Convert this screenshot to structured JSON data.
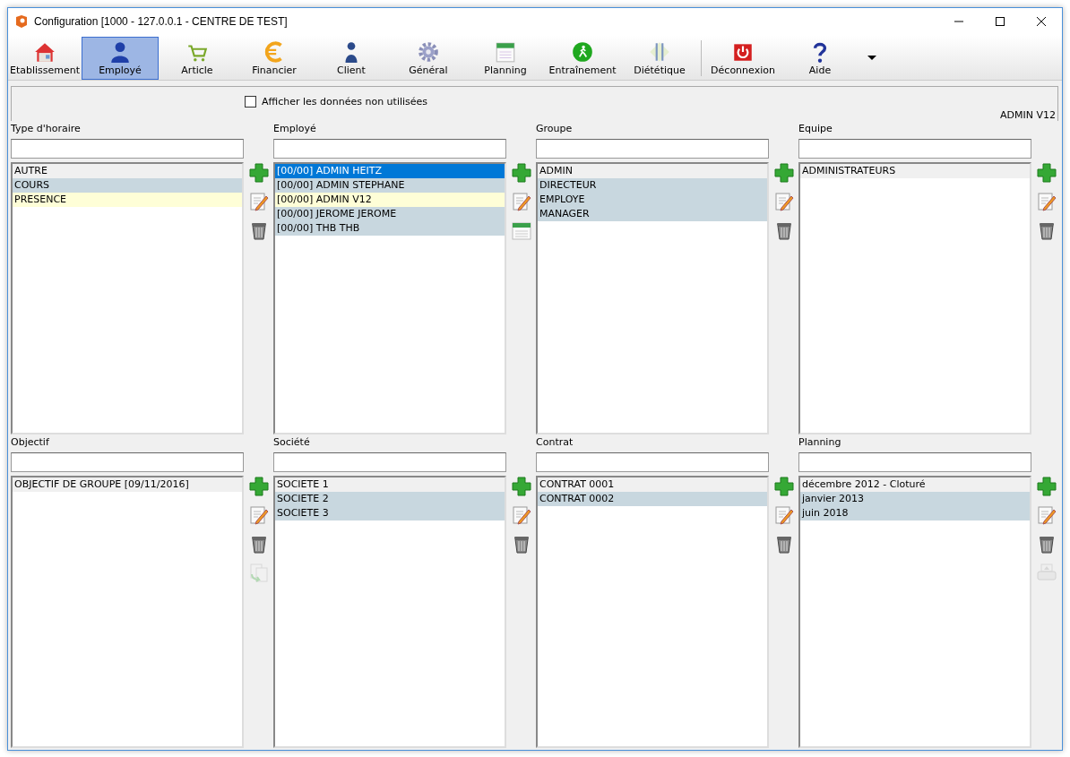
{
  "window": {
    "title": "Configuration [1000 - 127.0.0.1 - CENTRE DE TEST]"
  },
  "toolbar": {
    "items": [
      {
        "label": "Etablissement",
        "selected": false
      },
      {
        "label": "Employé",
        "selected": true
      },
      {
        "label": "Article",
        "selected": false
      },
      {
        "label": "Financier",
        "selected": false
      },
      {
        "label": "Client",
        "selected": false
      },
      {
        "label": "Général",
        "selected": false
      },
      {
        "label": "Planning",
        "selected": false
      },
      {
        "label": "Entraînement",
        "selected": false
      },
      {
        "label": "Diététique",
        "selected": false
      },
      {
        "label": "Déconnexion",
        "selected": false
      },
      {
        "label": "Aide",
        "selected": false
      }
    ]
  },
  "header": {
    "checkbox": {
      "label": "Afficher les données non utilisées",
      "checked": false
    },
    "user": "ADMIN V12"
  },
  "panels": [
    {
      "title": "Type d'horaire",
      "rows": [
        {
          "text": "AUTRE",
          "color": "#f0f0f0",
          "selected": false
        },
        {
          "text": "COURS",
          "color": "#c8d7df",
          "selected": false
        },
        {
          "text": "PRESENCE",
          "color": "#fefed7",
          "selected": false
        }
      ],
      "actions": [
        {
          "kind": "add",
          "disabled": false
        },
        {
          "kind": "edit",
          "disabled": false
        },
        {
          "kind": "delete",
          "disabled": false
        }
      ]
    },
    {
      "title": "Employé",
      "rows": [
        {
          "text": "[00/00] ADMIN HEITZ",
          "selected": true
        },
        {
          "text": "[00/00] ADMIN STEPHANE",
          "color": "#c8d7df",
          "selected": false
        },
        {
          "text": "[00/00] ADMIN V12",
          "color": "#fefed7",
          "selected": false
        },
        {
          "text": "[00/00] JEROME JEROME",
          "color": "#c8d7df",
          "selected": false
        },
        {
          "text": "[00/00] THB THB",
          "color": "#c8d7df",
          "selected": false
        }
      ],
      "actions": [
        {
          "kind": "add",
          "disabled": false
        },
        {
          "kind": "edit",
          "disabled": false
        },
        {
          "kind": "calendar",
          "disabled": false
        }
      ]
    },
    {
      "title": "Groupe",
      "rows": [
        {
          "text": "ADMIN",
          "color": "#f0f0f0",
          "selected": false
        },
        {
          "text": "DIRECTEUR",
          "color": "#c8d7df",
          "selected": false
        },
        {
          "text": "EMPLOYE",
          "color": "#c8d7df",
          "selected": false
        },
        {
          "text": "MANAGER",
          "color": "#c8d7df",
          "selected": false
        }
      ],
      "actions": [
        {
          "kind": "add",
          "disabled": false
        },
        {
          "kind": "edit",
          "disabled": false
        },
        {
          "kind": "delete",
          "disabled": false
        }
      ]
    },
    {
      "title": "Equipe",
      "rows": [
        {
          "text": "ADMINISTRATEURS",
          "color": "#f0f0f0",
          "selected": false
        }
      ],
      "actions": [
        {
          "kind": "add",
          "disabled": false
        },
        {
          "kind": "edit",
          "disabled": false
        },
        {
          "kind": "delete",
          "disabled": false
        }
      ]
    },
    {
      "title": "Objectif",
      "rows": [
        {
          "text": "OBJECTIF DE GROUPE [09/11/2016]",
          "color": "#f0f0f0",
          "selected": false
        }
      ],
      "actions": [
        {
          "kind": "add",
          "disabled": false
        },
        {
          "kind": "edit",
          "disabled": false
        },
        {
          "kind": "delete",
          "disabled": false
        },
        {
          "kind": "copy",
          "disabled": true
        }
      ]
    },
    {
      "title": "Société",
      "rows": [
        {
          "text": "SOCIETE 1",
          "color": "#f0f0f0",
          "selected": false
        },
        {
          "text": "SOCIETE 2",
          "color": "#c8d7df",
          "selected": false
        },
        {
          "text": "SOCIETE 3",
          "color": "#c8d7df",
          "selected": false
        }
      ],
      "actions": [
        {
          "kind": "add",
          "disabled": false
        },
        {
          "kind": "edit",
          "disabled": false
        },
        {
          "kind": "delete",
          "disabled": false
        }
      ]
    },
    {
      "title": "Contrat",
      "rows": [
        {
          "text": "CONTRAT 0001",
          "color": "#f0f0f0",
          "selected": false
        },
        {
          "text": "CONTRAT 0002",
          "color": "#c8d7df",
          "selected": false
        }
      ],
      "actions": [
        {
          "kind": "add",
          "disabled": false
        },
        {
          "kind": "edit",
          "disabled": false
        },
        {
          "kind": "delete",
          "disabled": false
        }
      ]
    },
    {
      "title": "Planning",
      "rows": [
        {
          "text": "décembre 2012 - Cloturé",
          "color": "#f0f0f0",
          "selected": false
        },
        {
          "text": "janvier 2013",
          "color": "#c8d7df",
          "selected": false
        },
        {
          "text": "juin 2018",
          "color": "#c8d7df",
          "selected": false
        }
      ],
      "actions": [
        {
          "kind": "add",
          "disabled": false
        },
        {
          "kind": "edit",
          "disabled": false
        },
        {
          "kind": "delete",
          "disabled": false
        },
        {
          "kind": "print",
          "disabled": true
        }
      ]
    }
  ]
}
